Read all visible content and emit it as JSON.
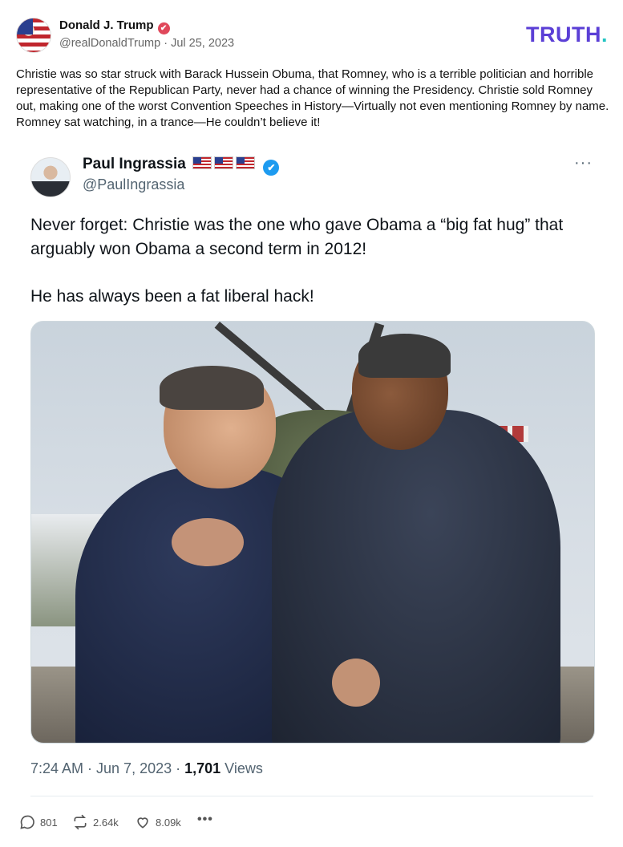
{
  "post": {
    "author_name": "Donald J. Trump",
    "handle_date": "@realDonaldTrump · Jul 25, 2023",
    "brand": "TRUTH",
    "brand_dot": ".",
    "text": "Christie was so star struck with Barack Hussein Obuma, that Romney, who is a terrible politician and horrible representative of the Republican Party, never had a chance of winning the Presidency. Christie sold Romney out, making one of the worst Convention Speeches in History—Virtually not even mentioning Romney by name. Romney sat watching, in a trance—He couldn’t believe it!",
    "colors": {
      "brand": "#5b3fd6",
      "brand_dot": "#22c4c2",
      "verified": "#e0485b"
    }
  },
  "tweet": {
    "name": "Paul Ingrassia",
    "handle": "@PaulIngrassia",
    "more": "···",
    "body_line1": "Never forget: Christie was the one who gave Obama a “big fat hug” that arguably won Obama a second term in 2012!",
    "body_line2": "He has always been a fat liberal hack!",
    "meta_prefix": "7:24 AM · Jun 7, 2023 · ",
    "views_count": "1,701",
    "views_label": " Views",
    "colors": {
      "verified": "#1d9bf0"
    }
  },
  "actions": {
    "replies": "801",
    "reposts": "2.64k",
    "likes": "8.09k",
    "more": "•••"
  }
}
